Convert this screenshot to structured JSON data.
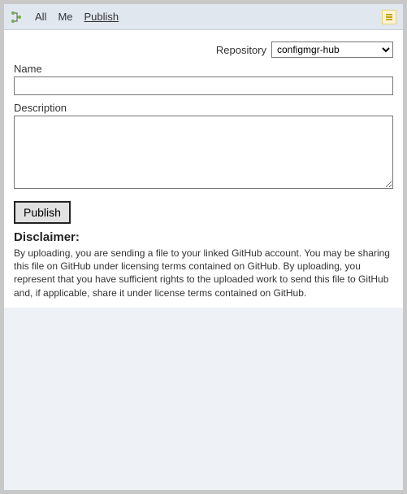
{
  "toolbar": {
    "tabs": {
      "all": "All",
      "me": "Me",
      "publish": "Publish"
    }
  },
  "form": {
    "repository_label": "Repository",
    "repository_options": [
      "configmgr-hub"
    ],
    "repository_selected": "configmgr-hub",
    "name_label": "Name",
    "name_value": "",
    "description_label": "Description",
    "description_value": "",
    "publish_button": "Publish"
  },
  "disclaimer": {
    "title": "Disclaimer:",
    "text": "By uploading, you are sending a file to your linked GitHub account. You may be sharing this file on GitHub under licensing terms contained on GitHub. By uploading, you represent that you have sufficient rights to the uploaded work to send this file to GitHub and, if applicable, share it under license terms contained on GitHub."
  }
}
